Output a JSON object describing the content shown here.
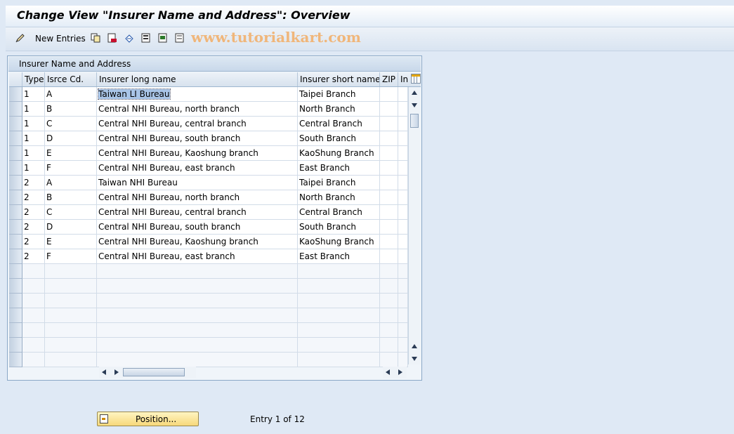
{
  "window": {
    "title": "Change View \"Insurer Name and Address\": Overview"
  },
  "toolbar": {
    "new_entries_label": "New Entries",
    "icons": [
      "edit-pen-icon",
      "copy-icon",
      "delete-icon",
      "undo-icon",
      "select-all-icon",
      "select-block-icon",
      "deselect-all-icon"
    ],
    "watermark": "www.tutorialkart.com"
  },
  "table": {
    "title": "Insurer Name and Address",
    "columns": [
      "Type",
      "Isrce Cd.",
      "Insurer long name",
      "Insurer short name",
      "ZIP",
      "In"
    ],
    "rows": [
      [
        "1",
        "A",
        "Taiwan LI Bureau",
        "Taipei Branch",
        "",
        ""
      ],
      [
        "1",
        "B",
        "Central NHI Bureau, north branch",
        "North Branch",
        "",
        ""
      ],
      [
        "1",
        "C",
        "Central NHI Bureau, central branch",
        "Central Branch",
        "",
        ""
      ],
      [
        "1",
        "D",
        "Central NHI Bureau, south branch",
        "South Branch",
        "",
        ""
      ],
      [
        "1",
        "E",
        "Central NHI Bureau, Kaoshung branch",
        "KaoShung Branch",
        "",
        ""
      ],
      [
        "1",
        "F",
        "Central NHI Bureau, east branch",
        "East Branch",
        "",
        ""
      ],
      [
        "2",
        "A",
        "Taiwan NHI Bureau",
        "Taipei Branch",
        "",
        ""
      ],
      [
        "2",
        "B",
        "Central NHI Bureau, north branch",
        "North Branch",
        "",
        ""
      ],
      [
        "2",
        "C",
        "Central NHI Bureau, central branch",
        "Central Branch",
        "",
        ""
      ],
      [
        "2",
        "D",
        "Central NHI Bureau, south branch",
        "South Branch",
        "",
        ""
      ],
      [
        "2",
        "E",
        "Central NHI Bureau, Kaoshung branch",
        "KaoShung Branch",
        "",
        ""
      ],
      [
        "2",
        "F",
        "Central NHI Bureau, east branch",
        "East Branch",
        "",
        ""
      ]
    ],
    "empty_rows": 7
  },
  "footer": {
    "position_button": "Position...",
    "entry_info": "Entry 1 of 12"
  }
}
